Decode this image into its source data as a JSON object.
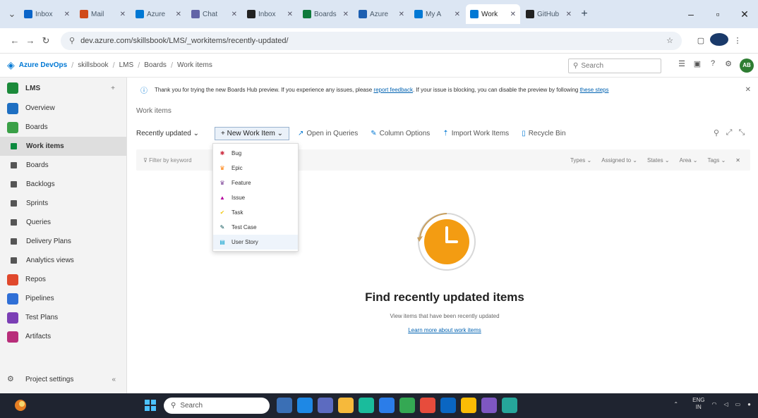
{
  "browser": {
    "tabs": [
      {
        "label": "Inbox",
        "color": "#0a64c8",
        "active": false
      },
      {
        "label": "Mail",
        "color": "#d04a1a",
        "active": false
      },
      {
        "label": "Azure",
        "color": "#0078d4",
        "active": false
      },
      {
        "label": "Chat",
        "color": "#6264a7",
        "active": false
      },
      {
        "label": "Inbox",
        "color": "#222222",
        "active": false
      },
      {
        "label": "Boards",
        "color": "#0e7a3b",
        "active": false
      },
      {
        "label": "Azure",
        "color": "#1d5fb1",
        "active": false
      },
      {
        "label": "My A",
        "color": "#0078d4",
        "active": false
      },
      {
        "label": "Work",
        "color": "#0078d4",
        "active": true
      },
      {
        "label": "GitHub",
        "color": "#222222",
        "active": false
      }
    ],
    "url": "dev.azure.com/skillsbook/LMS/_workitems/recently-updated/"
  },
  "header": {
    "product": "Azure DevOps",
    "breadcrumbs": [
      "skillsbook",
      "LMS",
      "Boards",
      "Work items"
    ],
    "search_placeholder": "Search"
  },
  "sidebar": {
    "project": "LMS",
    "items": [
      {
        "label": "Overview",
        "color": "#1e6fc2",
        "sub": false,
        "selected": false
      },
      {
        "label": "Boards",
        "color": "#3aa047",
        "sub": false,
        "selected": false
      },
      {
        "label": "Work items",
        "color": "#0b8a3e",
        "sub": true,
        "selected": true
      },
      {
        "label": "Boards",
        "color": "#555555",
        "sub": true,
        "selected": false
      },
      {
        "label": "Backlogs",
        "color": "#555555",
        "sub": true,
        "selected": false
      },
      {
        "label": "Sprints",
        "color": "#555555",
        "sub": true,
        "selected": false
      },
      {
        "label": "Queries",
        "color": "#555555",
        "sub": true,
        "selected": false
      },
      {
        "label": "Delivery Plans",
        "color": "#555555",
        "sub": true,
        "selected": false
      },
      {
        "label": "Analytics views",
        "color": "#555555",
        "sub": true,
        "selected": false
      },
      {
        "label": "Repos",
        "color": "#e0482c",
        "sub": false,
        "selected": false
      },
      {
        "label": "Pipelines",
        "color": "#2f6fd6",
        "sub": false,
        "selected": false
      },
      {
        "label": "Test Plans",
        "color": "#7b3fb5",
        "sub": false,
        "selected": false
      },
      {
        "label": "Artifacts",
        "color": "#b82e7a",
        "sub": false,
        "selected": false
      }
    ],
    "settings": "Project settings"
  },
  "main": {
    "banner_text": "Thank you for trying the new Boards Hub preview. If you experience any issues, please",
    "banner_link": "report feedback",
    "banner_text2": ". If your issue is blocking, you can disable the preview by following",
    "banner_link2": "these steps",
    "title": "Work items",
    "toolbar": {
      "view": "Recently updated",
      "new_item": "New Work Item",
      "open_queries": "Open in Queries",
      "column_options": "Column Options",
      "import": "Import Work Items",
      "recycle": "Recycle Bin"
    },
    "filter_placeholder": "Filter by keyword",
    "filters": [
      "Types",
      "Assigned to",
      "States",
      "Area",
      "Tags"
    ]
  },
  "new_item_menu": [
    {
      "label": "Bug",
      "color": "#cc293d",
      "glyph": "✱"
    },
    {
      "label": "Epic",
      "color": "#ff7b00",
      "glyph": "♛"
    },
    {
      "label": "Feature",
      "color": "#773b93",
      "glyph": "♛"
    },
    {
      "label": "Issue",
      "color": "#b4009e",
      "glyph": "▲"
    },
    {
      "label": "Task",
      "color": "#f2cb1d",
      "glyph": "✔"
    },
    {
      "label": "Test Case",
      "color": "#004b50",
      "glyph": "✎"
    },
    {
      "label": "User Story",
      "color": "#009ccc",
      "glyph": "▤"
    }
  ],
  "empty_state": {
    "title": "Find recently updated items",
    "subtitle": "View items that have been recently updated",
    "link": "Learn more about work items"
  },
  "taskbar": {
    "search": "Search",
    "tray_lang": "ENG",
    "tray_region": "IN"
  }
}
